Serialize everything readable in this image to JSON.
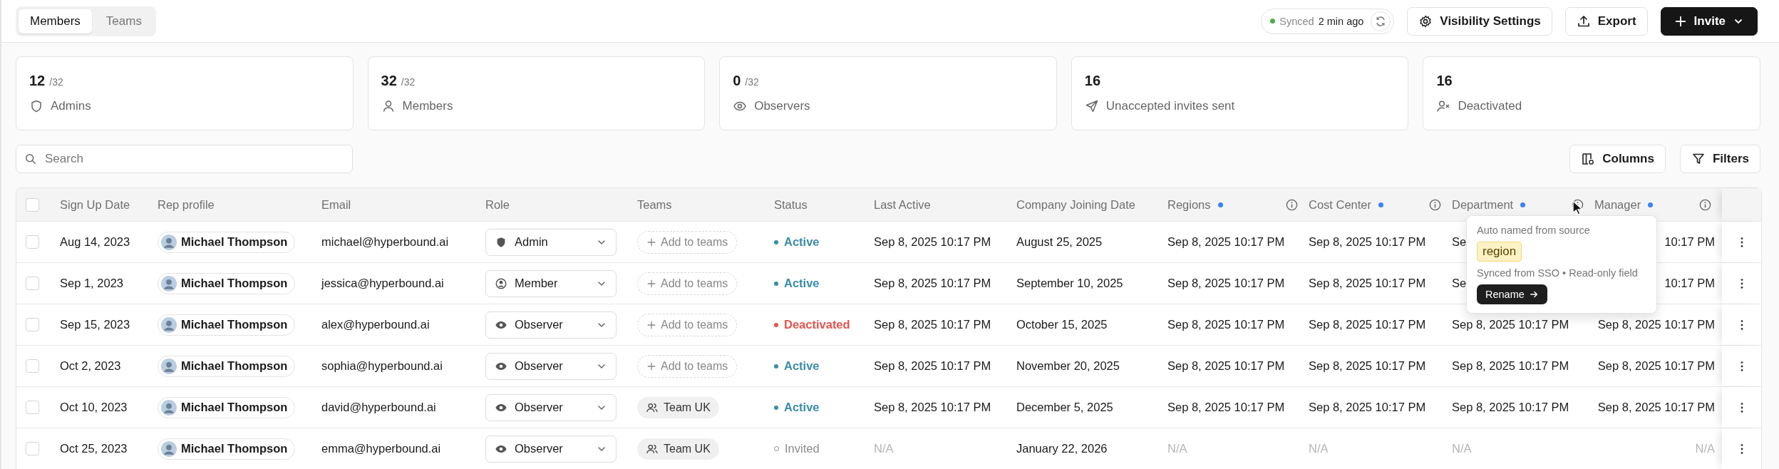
{
  "tabs": [
    {
      "label": "Members",
      "selected": true
    },
    {
      "label": "Teams",
      "selected": false
    }
  ],
  "sync": {
    "label": "Synced",
    "time": "2 min ago"
  },
  "actions": [
    {
      "label": "Visibility Settings",
      "kind": "settings"
    },
    {
      "label": "Export",
      "kind": "export"
    },
    {
      "label": "Invite",
      "kind": "invite"
    }
  ],
  "stats": [
    {
      "value": "12",
      "total": "/32",
      "label": "Admins",
      "kind": "admins"
    },
    {
      "value": "32",
      "total": "/32",
      "label": "Members",
      "kind": "members"
    },
    {
      "value": "0",
      "total": "/32",
      "label": "Observers",
      "kind": "observers"
    },
    {
      "value": "16",
      "label": "Unaccepted invites sent",
      "kind": "invites"
    },
    {
      "value": "16",
      "label": "Deactivated",
      "kind": "deactivated"
    }
  ],
  "search": {
    "placeholder": "Search"
  },
  "tools": [
    {
      "label": "Columns",
      "kind": "columns"
    },
    {
      "label": "Filters",
      "kind": "filters"
    }
  ],
  "table": {
    "select_all": {
      "checked": false
    },
    "columns": [
      {
        "label": "Sign Up Date",
        "dot": false,
        "info": false
      },
      {
        "label": "Rep profile",
        "dot": false,
        "info": false
      },
      {
        "label": "Email",
        "dot": false,
        "info": false
      },
      {
        "label": "Role",
        "dot": false,
        "info": false
      },
      {
        "label": "Teams",
        "dot": false,
        "info": false
      },
      {
        "label": "Status",
        "dot": false,
        "info": false
      },
      {
        "label": "Last Active",
        "dot": false,
        "info": false
      },
      {
        "label": "Company Joining Date",
        "dot": false,
        "info": false
      },
      {
        "label": "Regions",
        "dot": true,
        "info": true
      },
      {
        "label": "Cost Center",
        "dot": true,
        "info": true
      },
      {
        "label": "Department",
        "dot": true,
        "info": true
      },
      {
        "label": "Manager",
        "dot": true,
        "info": true
      }
    ],
    "rows": [
      {
        "checked": false,
        "muted": false,
        "sign_up": "Aug 14, 2023",
        "rep": "Michael Thompson",
        "email": "michael@hyperbound.ai",
        "role": {
          "label": "Admin",
          "kind": "admin"
        },
        "team": {
          "label": "Add to teams",
          "kind": "add"
        },
        "status": {
          "label": "Active",
          "kind": "active"
        },
        "last_active": "Sep 8, 2025 10:17 PM",
        "joining": "August 25, 2025",
        "regions": "Sep 8, 2025 10:17 PM",
        "cost_center": "Sep 8, 2025 10:17 PM",
        "department": "Se",
        "manager": "10:17 PM"
      },
      {
        "checked": false,
        "muted": false,
        "sign_up": "Sep 1, 2023",
        "rep": "Michael Thompson",
        "email": "jessica@hyperbound.ai",
        "role": {
          "label": "Member",
          "kind": "member"
        },
        "team": {
          "label": "Add to teams",
          "kind": "add"
        },
        "status": {
          "label": "Active",
          "kind": "active"
        },
        "last_active": "Sep 8, 2025 10:17 PM",
        "joining": "September 10, 2025",
        "regions": "Sep 8, 2025 10:17 PM",
        "cost_center": "Sep 8, 2025 10:17 PM",
        "department": "Se",
        "manager": "10:17 PM"
      },
      {
        "checked": false,
        "muted": false,
        "sign_up": "Sep 15, 2023",
        "rep": "Michael Thompson",
        "email": "alex@hyperbound.ai",
        "role": {
          "label": "Observer",
          "kind": "observer"
        },
        "team": {
          "label": "Add to teams",
          "kind": "add"
        },
        "status": {
          "label": "Deactivated",
          "kind": "deactivated"
        },
        "last_active": "Sep 8, 2025 10:17 PM",
        "joining": "October 15, 2025",
        "regions": "Sep 8, 2025 10:17 PM",
        "cost_center": "Sep 8, 2025 10:17 PM",
        "department": "Sep 8, 2025 10:17 PM",
        "manager": "Sep 8, 2025 10:17 PM"
      },
      {
        "checked": false,
        "muted": false,
        "sign_up": "Oct 2, 2023",
        "rep": "Michael Thompson",
        "email": "sophia@hyperbound.ai",
        "role": {
          "label": "Observer",
          "kind": "observer"
        },
        "team": {
          "label": "Add to teams",
          "kind": "add"
        },
        "status": {
          "label": "Active",
          "kind": "active"
        },
        "last_active": "Sep 8, 2025 10:17 PM",
        "joining": "November 20, 2025",
        "regions": "Sep 8, 2025 10:17 PM",
        "cost_center": "Sep 8, 2025 10:17 PM",
        "department": "Sep 8, 2025 10:17 PM",
        "manager": "Sep 8, 2025 10:17 PM"
      },
      {
        "checked": false,
        "muted": false,
        "sign_up": "Oct 10, 2023",
        "rep": "Michael Thompson",
        "email": "david@hyperbound.ai",
        "role": {
          "label": "Observer",
          "kind": "observer"
        },
        "team": {
          "label": "Team UK",
          "kind": "team"
        },
        "status": {
          "label": "Active",
          "kind": "active"
        },
        "last_active": "Sep 8, 2025 10:17 PM",
        "joining": "December 5, 2025",
        "regions": "Sep 8, 2025 10:17 PM",
        "cost_center": "Sep 8, 2025 10:17 PM",
        "department": "Sep 8, 2025 10:17 PM",
        "manager": "Sep 8, 2025 10:17 PM"
      },
      {
        "checked": false,
        "muted": true,
        "sign_up": "Oct 25, 2023",
        "rep": "Michael Thompson",
        "email": "emma@hyperbound.ai",
        "role": {
          "label": "Observer",
          "kind": "observer"
        },
        "team": {
          "label": "Team UK",
          "kind": "team"
        },
        "status": {
          "label": "Invited",
          "kind": "invited"
        },
        "last_active": "N/A",
        "joining": "January 22, 2026",
        "regions": "N/A",
        "cost_center": "N/A",
        "department": "N/A",
        "manager": "N/A"
      }
    ]
  },
  "tooltip": {
    "heading": "Auto named from source",
    "tag": "region",
    "note": "Synced from SSO • Read-only field",
    "button": "Rename"
  }
}
